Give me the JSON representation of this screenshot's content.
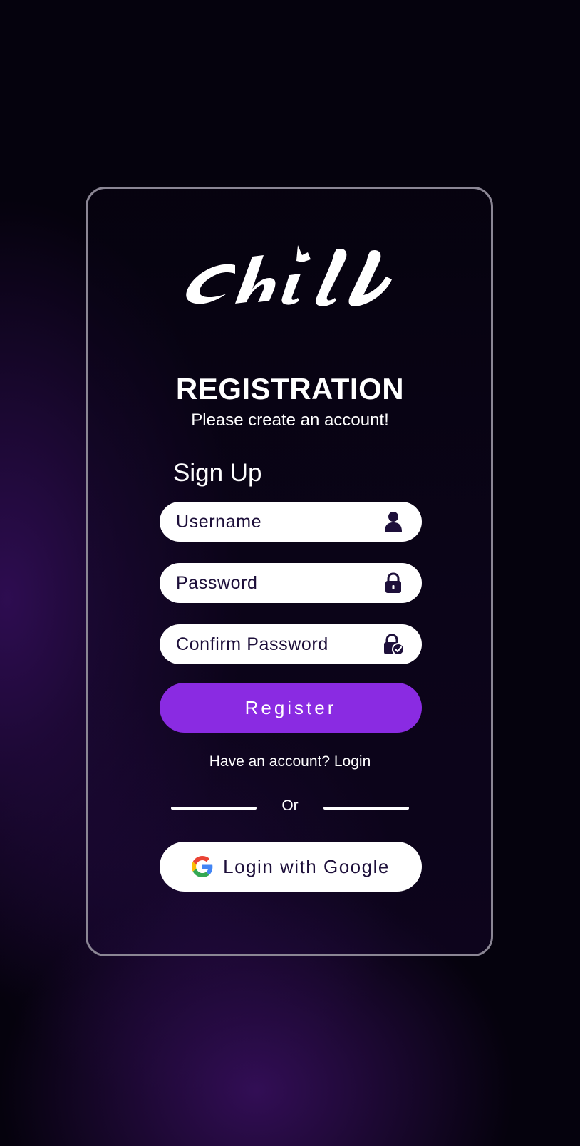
{
  "brand": {
    "logo_text": "chill"
  },
  "header": {
    "title": "REGISTRATION",
    "subtitle": "Please create an account!"
  },
  "form": {
    "heading": "Sign Up",
    "username": {
      "placeholder": "Username",
      "value": "",
      "icon": "user-icon"
    },
    "password": {
      "placeholder": "Password",
      "value": "",
      "icon": "lock-icon"
    },
    "confirm_password": {
      "placeholder": "Confirm Password",
      "value": "",
      "icon": "lock-check-icon"
    },
    "register_label": "Register"
  },
  "footer": {
    "have_account_text": "Have an account?",
    "login_label": "Login",
    "divider_text": "Or",
    "google_label": "Login with Google",
    "google_icon": "google-icon"
  },
  "colors": {
    "background": "#05020d",
    "accent": "#8a2be2",
    "input_text": "#1d0f3a",
    "card_border": "#8b8694"
  }
}
